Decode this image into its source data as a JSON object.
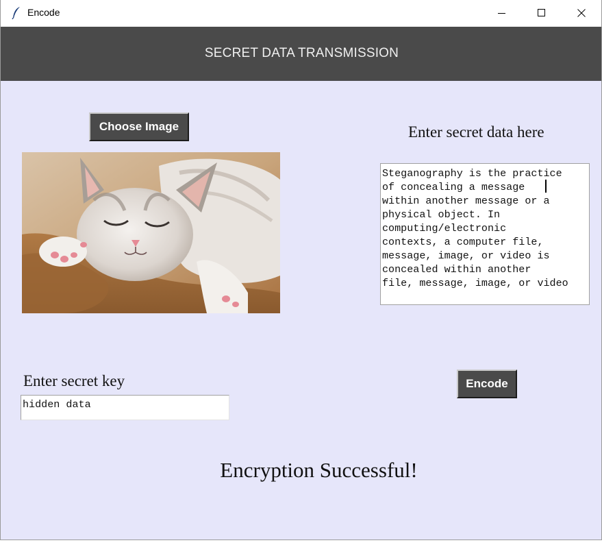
{
  "window": {
    "title": "Encode",
    "controls": [
      "minimize-icon",
      "maximize-icon",
      "close-icon"
    ]
  },
  "header": {
    "title": "SECRET DATA TRANSMISSION"
  },
  "image_panel": {
    "choose_button_label": "Choose Image",
    "image_subject": "sleeping white and grey kitten on a brown blanket"
  },
  "secret_data": {
    "label": "Enter secret data here",
    "text": "Steganography is the practice\nof concealing a message \nwithin another message or a\nphysical object. In\ncomputing/electronic\ncontexts, a computer file,\nmessage, image, or video is\nconcealed within another\nfile, message, image, or video"
  },
  "secret_key": {
    "label": "Enter secret key",
    "value": "hidden data"
  },
  "actions": {
    "encode_label": "Encode"
  },
  "status": {
    "message": "Encryption Successful!"
  },
  "colors": {
    "window_bg": "#e6e6fa",
    "header_bg": "#4a4a4a",
    "button_bg": "#4a4a4a",
    "button_text": "#ffffff"
  }
}
